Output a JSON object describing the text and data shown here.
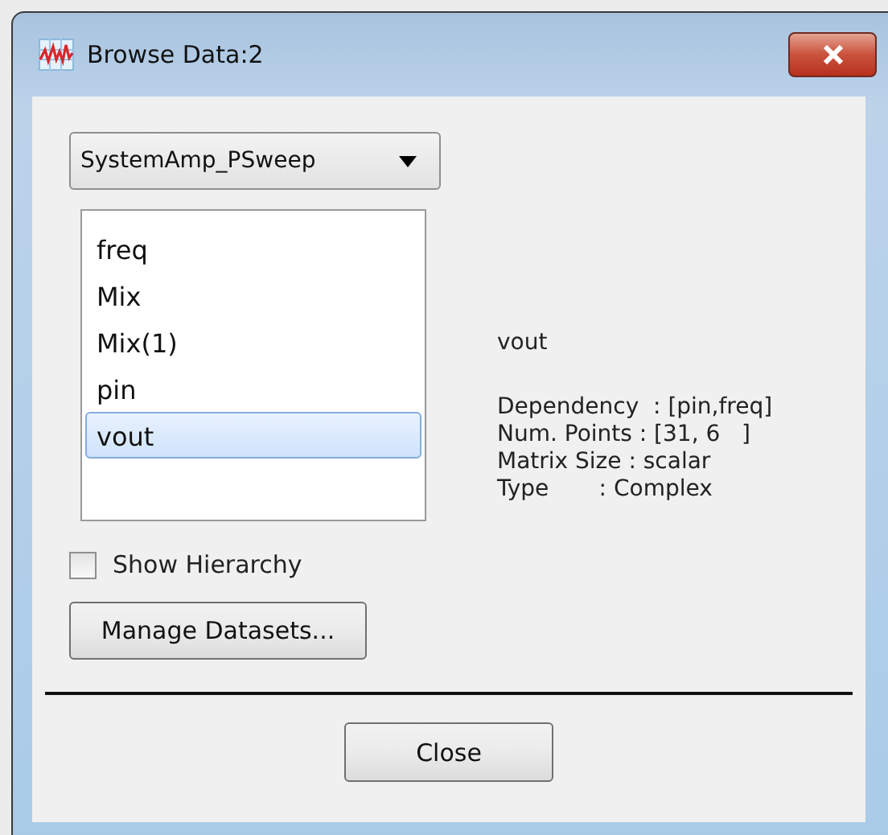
{
  "window": {
    "title": "Browse Data:2"
  },
  "dataset_dropdown": {
    "value": "SystemAmp_PSweep"
  },
  "variables": [
    {
      "label": "freq",
      "selected": false
    },
    {
      "label": "Mix",
      "selected": false
    },
    {
      "label": "Mix(1)",
      "selected": false
    },
    {
      "label": "pin",
      "selected": false
    },
    {
      "label": "vout",
      "selected": true
    }
  ],
  "show_hierarchy": {
    "label": "Show Hierarchy",
    "checked": false
  },
  "manage_button": "Manage Datasets...",
  "details": {
    "name": "vout",
    "lines": [
      "Dependency  : [pin,freq]",
      "Num. Points : [31, 6   ]",
      "Matrix Size : scalar",
      "Type       : Complex"
    ]
  },
  "close_button": "Close"
}
